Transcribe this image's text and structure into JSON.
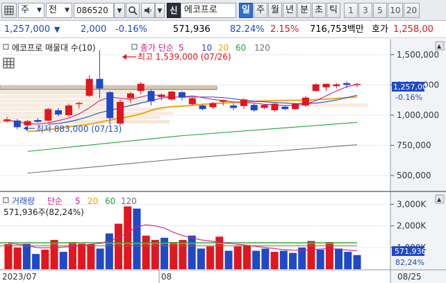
{
  "toolbar": {
    "grid_icon": "grid-icon",
    "market_label": "주",
    "period_prefix": "전",
    "stock_code": "086520",
    "new_badge": "신",
    "stock_name": "에코프로",
    "timeframes": [
      "일",
      "주",
      "월",
      "년",
      "분",
      "초",
      "틱"
    ],
    "selected_timeframe": "일",
    "counts": [
      "1",
      "3",
      "5",
      "10",
      "20"
    ]
  },
  "quote": {
    "price": "1,257,000",
    "direction_icon": "down-triangle-icon",
    "change": "2,000",
    "change_pct": "-0.16%",
    "volume": "571,936",
    "volume_ratio": "82.24%",
    "turnover_pct": "2.15%",
    "trade_value": "716,753백만",
    "bid_label": "호가",
    "bid_price": "1,258,00"
  },
  "colors": {
    "up": "#e3161d",
    "down": "#1f49c7",
    "ma5": "#d2188a",
    "ma10": "#1f49c7",
    "ma20": "#f2a20c",
    "ma60": "#1ea43c",
    "ma120": "#707070"
  },
  "chart_data": {
    "type": "candlestick",
    "price_panel": {
      "title": "에코프로 매물대 수(10)",
      "legend_prefix": "종가 단순",
      "ma_periods": [
        "5",
        "10",
        "20",
        "60",
        "120"
      ],
      "y_ticks": [
        "1,500,000",
        "1,250,000",
        "1,000,000",
        "750,000",
        "500,000"
      ],
      "ylim": [
        380000,
        1620000
      ],
      "high_label": "최고 1,539,000 (07/26)",
      "low_label": "최저 883,000 (07/13)",
      "current_price_label": "1,257,000",
      "current_change_label": "-0.16%",
      "candles": [
        {
          "o": 950000,
          "h": 985000,
          "l": 940000,
          "c": 965000
        },
        {
          "o": 955000,
          "h": 970000,
          "l": 883000,
          "c": 900000
        },
        {
          "o": 915000,
          "h": 960000,
          "l": 905000,
          "c": 950000
        },
        {
          "o": 960000,
          "h": 975000,
          "l": 935000,
          "c": 945000
        },
        {
          "o": 955000,
          "h": 1060000,
          "l": 950000,
          "c": 1050000
        },
        {
          "o": 1040000,
          "h": 1060000,
          "l": 990000,
          "c": 1005000
        },
        {
          "o": 1000000,
          "h": 1095000,
          "l": 985000,
          "c": 1080000
        },
        {
          "o": 1095000,
          "h": 1110000,
          "l": 1055000,
          "c": 1100000
        },
        {
          "o": 1160000,
          "h": 1330000,
          "l": 1150000,
          "c": 1300000
        },
        {
          "o": 1300000,
          "h": 1539000,
          "l": 1140000,
          "c": 1220000
        },
        {
          "o": 1190000,
          "h": 1200000,
          "l": 920000,
          "c": 975000
        },
        {
          "o": 930000,
          "h": 1130000,
          "l": 920000,
          "c": 1110000
        },
        {
          "o": 1140000,
          "h": 1190000,
          "l": 1100000,
          "c": 1180000
        },
        {
          "o": 1200000,
          "h": 1275000,
          "l": 1170000,
          "c": 1260000
        },
        {
          "o": 1200000,
          "h": 1215000,
          "l": 1080000,
          "c": 1115000
        },
        {
          "o": 1150000,
          "h": 1180000,
          "l": 1120000,
          "c": 1170000
        },
        {
          "o": 1130000,
          "h": 1200000,
          "l": 1120000,
          "c": 1195000
        },
        {
          "o": 1190000,
          "h": 1200000,
          "l": 1120000,
          "c": 1145000
        },
        {
          "o": 1090000,
          "h": 1150000,
          "l": 1080000,
          "c": 1140000
        },
        {
          "o": 1080000,
          "h": 1090000,
          "l": 1040000,
          "c": 1050000
        },
        {
          "o": 1065000,
          "h": 1110000,
          "l": 1050000,
          "c": 1100000
        },
        {
          "o": 1110000,
          "h": 1130000,
          "l": 1080000,
          "c": 1125000
        },
        {
          "o": 1080000,
          "h": 1100000,
          "l": 1040000,
          "c": 1060000
        },
        {
          "o": 1075000,
          "h": 1140000,
          "l": 1050000,
          "c": 1130000
        },
        {
          "o": 1085000,
          "h": 1095000,
          "l": 1030000,
          "c": 1040000
        },
        {
          "o": 1060000,
          "h": 1090000,
          "l": 1050000,
          "c": 1085000
        },
        {
          "o": 1040000,
          "h": 1100000,
          "l": 1030000,
          "c": 1095000
        },
        {
          "o": 1070000,
          "h": 1080000,
          "l": 1040000,
          "c": 1050000
        },
        {
          "o": 1050000,
          "h": 1100000,
          "l": 1045000,
          "c": 1095000
        },
        {
          "o": 1080000,
          "h": 1160000,
          "l": 1070000,
          "c": 1145000
        },
        {
          "o": 1200000,
          "h": 1265000,
          "l": 1195000,
          "c": 1255000
        },
        {
          "o": 1230000,
          "h": 1262000,
          "l": 1200000,
          "c": 1259000
        },
        {
          "o": 1240000,
          "h": 1265000,
          "l": 1220000,
          "c": 1255000
        },
        {
          "o": 1265000,
          "h": 1280000,
          "l": 1225000,
          "c": 1250000
        },
        {
          "o": 1255000,
          "h": 1270000,
          "l": 1230000,
          "c": 1257000
        }
      ],
      "ma_lines": {
        "ma5": [
          960000,
          945000,
          930000,
          925000,
          935000,
          955000,
          975000,
          1010000,
          1060000,
          1120000,
          1150000,
          1140000,
          1130000,
          1150000,
          1170000,
          1160000,
          1150000,
          1150000,
          1160000,
          1145000,
          1130000,
          1120000,
          1110000,
          1105000,
          1100000,
          1090000,
          1085000,
          1080000,
          1080000,
          1090000,
          1120000,
          1160000,
          1200000,
          1235000,
          1255000
        ],
        "ma10": [
          null,
          null,
          null,
          null,
          925000,
          930000,
          945000,
          965000,
          990000,
          1020000,
          1040000,
          1060000,
          1080000,
          1100000,
          1120000,
          1140000,
          1150000,
          1150000,
          1150000,
          1150000,
          1150000,
          1145000,
          1135000,
          1125000,
          1115000,
          1110000,
          1105000,
          1100000,
          1095000,
          1095000,
          1100000,
          1110000,
          1125000,
          1145000,
          1165000
        ],
        "ma20": [
          null,
          null,
          865000,
          870000,
          880000,
          890000,
          905000,
          915000,
          925000,
          940000,
          960000,
          975000,
          990000,
          1010000,
          1040000,
          1060000,
          1070000,
          1075000,
          1080000,
          1090000,
          1095000,
          1100000,
          1105000,
          1110000,
          1115000,
          1118000,
          1120000,
          1122000,
          1123000,
          1125000,
          1128000,
          1132000,
          1138000,
          1145000,
          1150000
        ],
        "ma60": [
          null,
          null,
          700000,
          null,
          null,
          null,
          null,
          null,
          null,
          null,
          null,
          null,
          null,
          null,
          null,
          null,
          null,
          830000,
          null,
          null,
          null,
          null,
          null,
          null,
          null,
          null,
          null,
          null,
          null,
          null,
          null,
          null,
          null,
          null,
          940000
        ],
        "ma120": [
          null,
          null,
          520000,
          null,
          null,
          null,
          null,
          null,
          null,
          null,
          null,
          null,
          null,
          null,
          null,
          null,
          null,
          640000,
          null,
          null,
          null,
          null,
          null,
          null,
          null,
          null,
          null,
          null,
          null,
          null,
          null,
          null,
          null,
          null,
          755000
        ]
      }
    },
    "volume_panel": {
      "title": "거래량",
      "legend_prefix": "단순",
      "ma_periods": [
        "5",
        "20",
        "60",
        "120"
      ],
      "current_label": "571,936주(82,24%)",
      "y_ticks": [
        "3,000K",
        "2,000K",
        "1,000K"
      ],
      "ylim": [
        0,
        3400000
      ],
      "current_value_label": "571,936",
      "current_ratio_label": "82,24%",
      "values": [
        1150000,
        1000000,
        1180000,
        700000,
        900000,
        1350000,
        800000,
        1250000,
        1200000,
        1150000,
        950000,
        1650000,
        2100000,
        2900000,
        2800000,
        1550000,
        1350000,
        1450000,
        1250000,
        1350000,
        1550000,
        950000,
        1050000,
        1500000,
        850000,
        1050000,
        1100000,
        850000,
        950000,
        800000,
        850000,
        750000,
        1000000,
        1300000,
        900000,
        1250000,
        950000,
        800000,
        650000
      ],
      "colors": [
        "up",
        "up",
        "down",
        "down",
        "up",
        "up",
        "down",
        "up",
        "up",
        "up",
        "down",
        "down",
        "up",
        "up",
        "down",
        "up",
        "up",
        "down",
        "up",
        "up",
        "down",
        "down",
        "up",
        "up",
        "down",
        "up",
        "up",
        "down",
        "down",
        "up",
        "down",
        "down",
        "down",
        "up",
        "down",
        "up",
        "down",
        "down",
        "down"
      ],
      "ma5": [
        1200000,
        1150000,
        1100000,
        1000000,
        980000,
        1000000,
        1020000,
        1050000,
        1080000,
        1150000,
        1200000,
        1300000,
        1450000,
        1700000,
        1950000,
        2050000,
        2000000,
        1900000,
        1700000,
        1550000,
        1450000,
        1350000,
        1300000,
        1250000,
        1200000,
        1150000,
        1100000,
        1050000,
        1000000,
        950000,
        900000,
        880000,
        870000,
        900000,
        930000,
        950000,
        920000,
        880000,
        850000
      ],
      "ma20": 1180000,
      "ma60": 1230000,
      "ma120": 1080000
    },
    "x_labels": [
      "2023/07",
      "08",
      "08/25"
    ]
  }
}
